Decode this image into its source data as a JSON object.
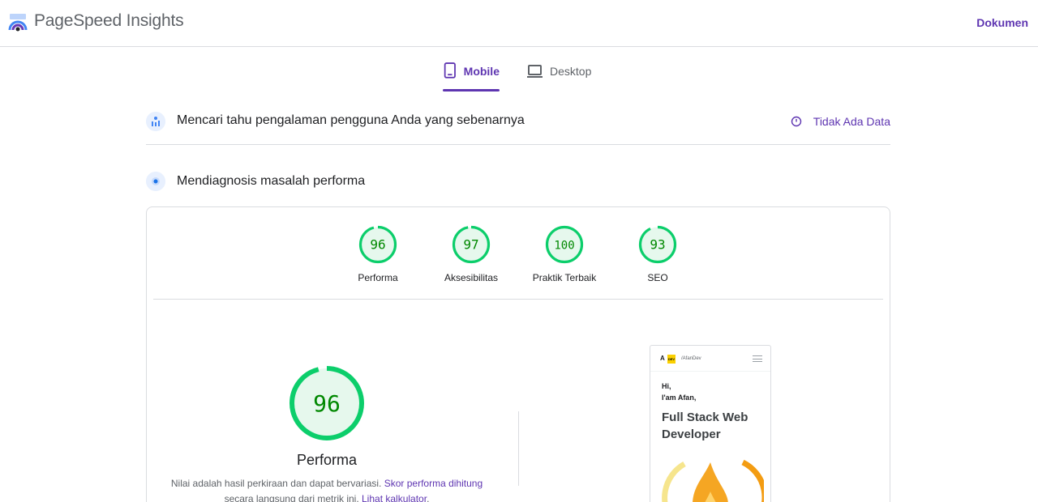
{
  "header": {
    "brand": "PageSpeed Insights",
    "docs_link": "Dokumen",
    "logo_icon": "pagespeed-logo-icon"
  },
  "tabs": [
    {
      "label": "Mobile",
      "icon": "phone-icon",
      "active": true
    },
    {
      "label": "Desktop",
      "icon": "laptop-icon",
      "active": false
    }
  ],
  "ux_section": {
    "title": "Mencari tahu pengalaman pengguna Anda yang sebenarnya",
    "status": "Tidak Ada Data",
    "icon": "users-chart-icon",
    "status_icon": "clock-icon"
  },
  "diag_section": {
    "title": "Mendiagnosis masalah performa",
    "icon": "lighthouse-icon"
  },
  "scores": [
    {
      "label": "Performa",
      "value": 96
    },
    {
      "label": "Aksesibilitas",
      "value": 97
    },
    {
      "label": "Praktik Terbaik",
      "value": 100
    },
    {
      "label": "SEO",
      "value": 93
    }
  ],
  "main_score": {
    "value": 96,
    "label": "Performa",
    "note_text_1": "Nilai adalah hasil perkiraan dan dapat bervariasi.",
    "note_link_1": "Skor performa dihitung",
    "note_text_2": "secara langsung dari metrik ini.",
    "note_link_2": "Lihat kalkulator",
    "note_end": "."
  },
  "thumbnail": {
    "logo_letter": "A",
    "logo_badge": "DEV",
    "handle": "/AfanDev",
    "greeting_1": "Hi,",
    "greeting_2": "I'am Afan,",
    "role": "Full Stack Web Developer"
  },
  "colors": {
    "accent": "#5e35b1",
    "pass": "#0cce6b",
    "pass_text": "#008800",
    "pass_bg": "#e6f8ed"
  }
}
